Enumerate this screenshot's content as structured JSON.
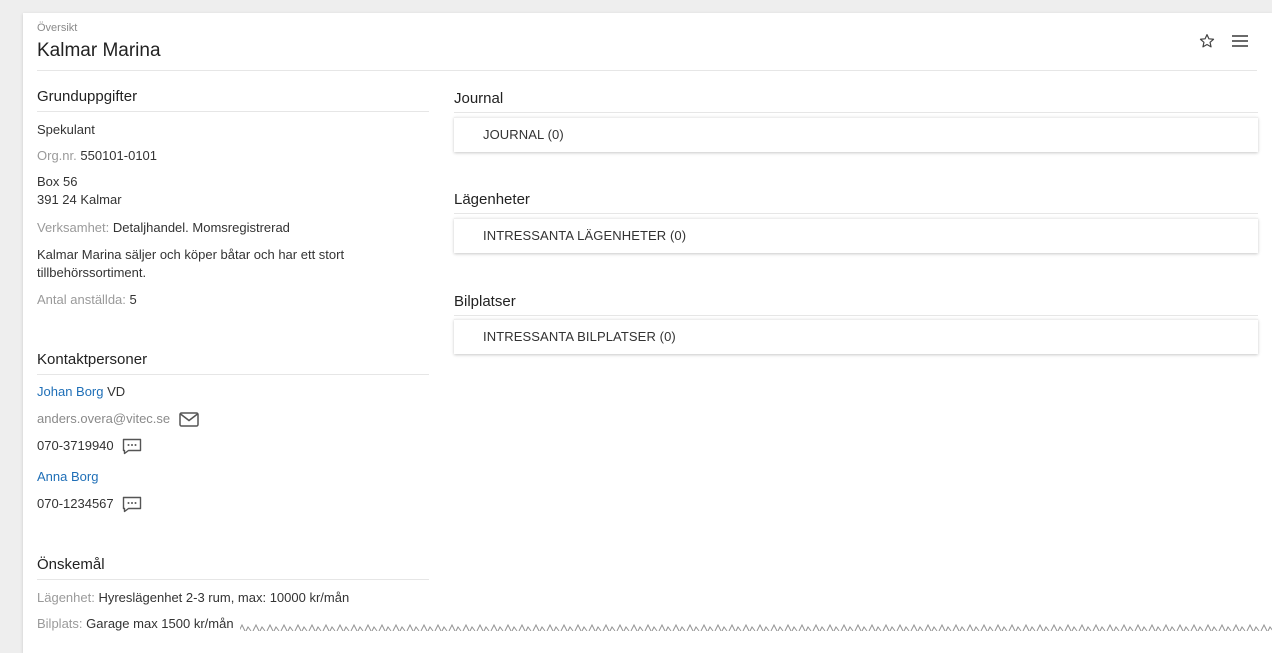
{
  "header": {
    "breadcrumb": "Översikt",
    "title": "Kalmar Marina",
    "icons": [
      "star-icon",
      "menu-icon"
    ]
  },
  "grunduppgifter": {
    "title": "Grunduppgifter",
    "status": "Spekulant",
    "orgnr_label": "Org.nr.",
    "orgnr": "550101-0101",
    "address_line1": "Box 56",
    "address_line2": "391 24 Kalmar",
    "verksamhet_label": "Verksamhet:",
    "verksamhet": "Detaljhandel. Momsregistrerad",
    "description_line1": "Kalmar Marina säljer och köper båtar och har ett stort",
    "description_line2": "tillbehörssortiment.",
    "anstallda_label": "Antal anställda:",
    "anstallda": "5"
  },
  "kontaktpersoner": {
    "title": "Kontaktpersoner",
    "contacts": [
      {
        "name": "Johan Borg",
        "role": "VD",
        "email": "anders.overa@vitec.se",
        "phone": "070-3719940"
      },
      {
        "name": "Anna Borg",
        "phone": "070-1234567"
      }
    ]
  },
  "onskemal": {
    "title": "Önskemål",
    "lagenhet_label": "Lägenhet:",
    "lagenhet": "Hyreslägenhet 2-3 rum, max: 10000 kr/mån",
    "bilplats_label": "Bilplats:",
    "bilplats": "Garage max 1500 kr/mån"
  },
  "journal": {
    "title": "Journal",
    "panel_label": "JOURNAL (0)"
  },
  "lagenheter": {
    "title": "Lägenheter",
    "panel_label": "INTRESSANTA LÄGENHETER  (0)"
  },
  "bilplatser": {
    "title": "Bilplatser",
    "panel_label": "INTRESSANTA BILPLATSER  (0)"
  },
  "colors": {
    "link": "#1f6fb7",
    "muted": "#9a9a9a",
    "rule": "#e6e6e6",
    "background": "#eeeeee"
  }
}
